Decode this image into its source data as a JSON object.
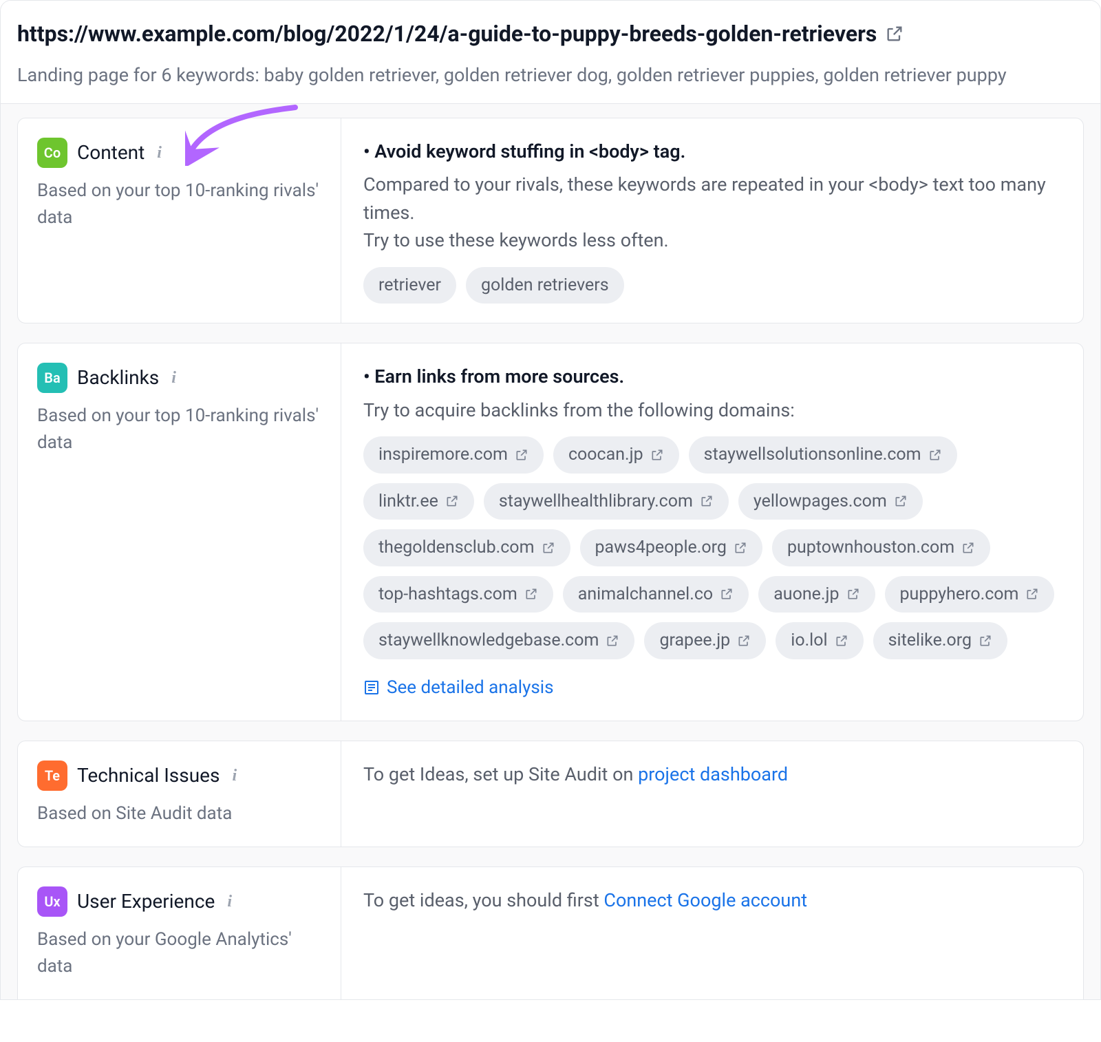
{
  "header": {
    "url": "https://www.example.com/blog/2022/1/24/a-guide-to-puppy-breeds-golden-retrievers",
    "subtitle": "Landing page for 6 keywords: baby golden retriever, golden retriever dog, golden retriever puppies, golden retriever puppy"
  },
  "cards": {
    "content": {
      "badge": "Co",
      "title": "Content",
      "subtext": "Based on your top 10-ranking rivals' data",
      "idea_title": "• Avoid keyword stuffing in <body> tag.",
      "idea_desc_line1": "Compared to your rivals, these keywords are repeated in your <body> text too many times.",
      "idea_desc_line2": "Try to use these keywords less often.",
      "keywords": [
        "retriever",
        "golden retrievers"
      ]
    },
    "backlinks": {
      "badge": "Ba",
      "title": "Backlinks",
      "subtext": "Based on your top 10-ranking rivals' data",
      "idea_title": "• Earn links from more sources.",
      "idea_desc": "Try to acquire backlinks from the following domains:",
      "domains": [
        "inspiremore.com",
        "coocan.jp",
        "staywellsolutionsonline.com",
        "linktr.ee",
        "staywellhealthlibrary.com",
        "yellowpages.com",
        "thegoldensclub.com",
        "paws4people.org",
        "puptownhouston.com",
        "top-hashtags.com",
        "animalchannel.co",
        "auone.jp",
        "puppyhero.com",
        "staywellknowledgebase.com",
        "grapee.jp",
        "io.lol",
        "sitelike.org"
      ],
      "detailed_link": "See detailed analysis"
    },
    "technical": {
      "badge": "Te",
      "title": "Technical Issues",
      "subtext": "Based on Site Audit data",
      "idea_prefix": "To get Ideas, set up Site Audit on ",
      "idea_link": "project dashboard"
    },
    "ux": {
      "badge": "Ux",
      "title": "User Experience",
      "subtext": "Based on your Google Analytics' data",
      "idea_prefix": "To get ideas, you should first ",
      "idea_link": "Connect Google account"
    }
  }
}
